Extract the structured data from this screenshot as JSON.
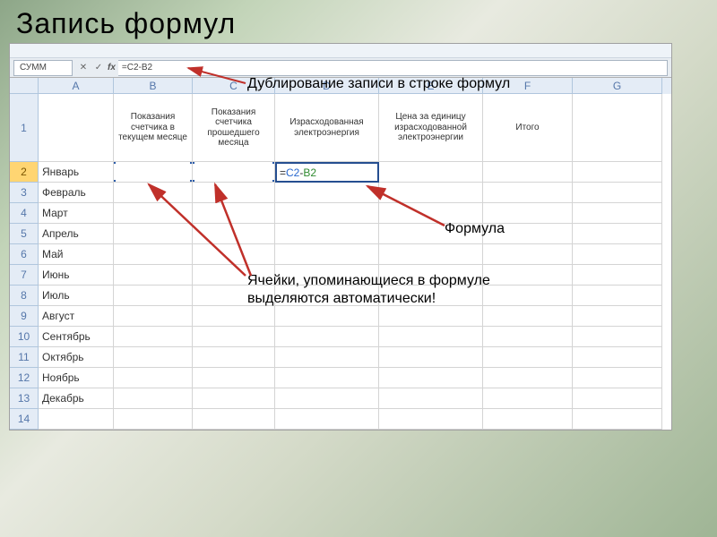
{
  "slide": {
    "title": "Запись формул"
  },
  "ribbon": {
    "tabs": [
      "",
      "",
      "",
      "",
      "",
      "",
      ""
    ]
  },
  "namebox": "СУММ",
  "formula_bar": "=C2-B2",
  "columns": [
    "A",
    "B",
    "C",
    "D",
    "E",
    "F",
    "G"
  ],
  "rows": [
    1,
    2,
    3,
    4,
    5,
    6,
    7,
    8,
    9,
    10,
    11,
    12,
    13,
    14
  ],
  "headers": {
    "B": "Показания счетчика в текущем месяце",
    "C": "Показания счетчика прошедшего месяца",
    "D": "Израсходованная электроэнергия",
    "E": "Цена за единицу израсходованной электроэнергии",
    "F": "Итого"
  },
  "months": [
    "Январь",
    "Февраль",
    "Март",
    "Апрель",
    "Май",
    "Июнь",
    "Июль",
    "Август",
    "Сентябрь",
    "Октябрь",
    "Ноябрь",
    "Декабрь"
  ],
  "active_cell": {
    "ref": "D2",
    "eq": "=",
    "ref1": "C2",
    "op": "-",
    "ref2": "B2"
  },
  "annotations": {
    "dup": "Дублирование записи в строке формул",
    "formula": "Формула",
    "cells": "Ячейки, упоминающиеся в формуле выделяются автоматически!"
  }
}
